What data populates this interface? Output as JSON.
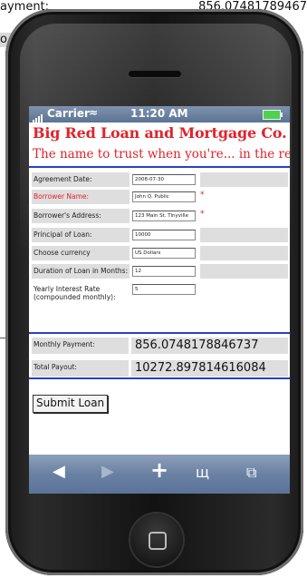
{
  "background": {
    "top_left_fragment": "ayment:",
    "top_right_fragment": "856.07481789467",
    "band_fragment": "o"
  },
  "status_bar": {
    "carrier": "Carrier",
    "time": "11:20 AM"
  },
  "header": {
    "title": "Big Red Loan and Mortgage Co.",
    "subtitle": "The name to trust when you're... in the red."
  },
  "form": {
    "fields": [
      {
        "label": "Agreement Date:",
        "value": "2008-07-30",
        "required": false
      },
      {
        "label": "Borrower Name:",
        "value": "John Q. Public",
        "required": true
      },
      {
        "label": "Borrower's Address:",
        "value": "123 Main St. Tinyville",
        "required": true
      },
      {
        "label": "Principal of Loan:",
        "value": "10000",
        "required": false
      },
      {
        "label": "Choose currency",
        "value": "US Dollars",
        "required": false
      },
      {
        "label": "Duration of Loan in Months:",
        "value": "12",
        "required": false
      },
      {
        "label": "Yearly Interest Rate (compounded monthly):",
        "value": "5",
        "required": false
      }
    ],
    "required_marker": "*"
  },
  "results": {
    "monthly_payment_label": "Monthly Payment:",
    "monthly_payment_value": "856.0748178846737",
    "total_payout_label": "Total Payout:",
    "total_payout_value": "10272.897814616084"
  },
  "actions": {
    "submit_label": "Submit Loan"
  },
  "toolbar": {
    "back_icon": "back-arrow-icon",
    "forward_icon": "forward-arrow-icon",
    "add_icon": "plus-icon",
    "bookmarks_icon": "bookmarks-icon",
    "pages_icon": "pages-icon"
  },
  "colors": {
    "brand_red": "#e0242b",
    "divider_blue": "#2b3fc4",
    "status_bar": "#6a81a3"
  }
}
